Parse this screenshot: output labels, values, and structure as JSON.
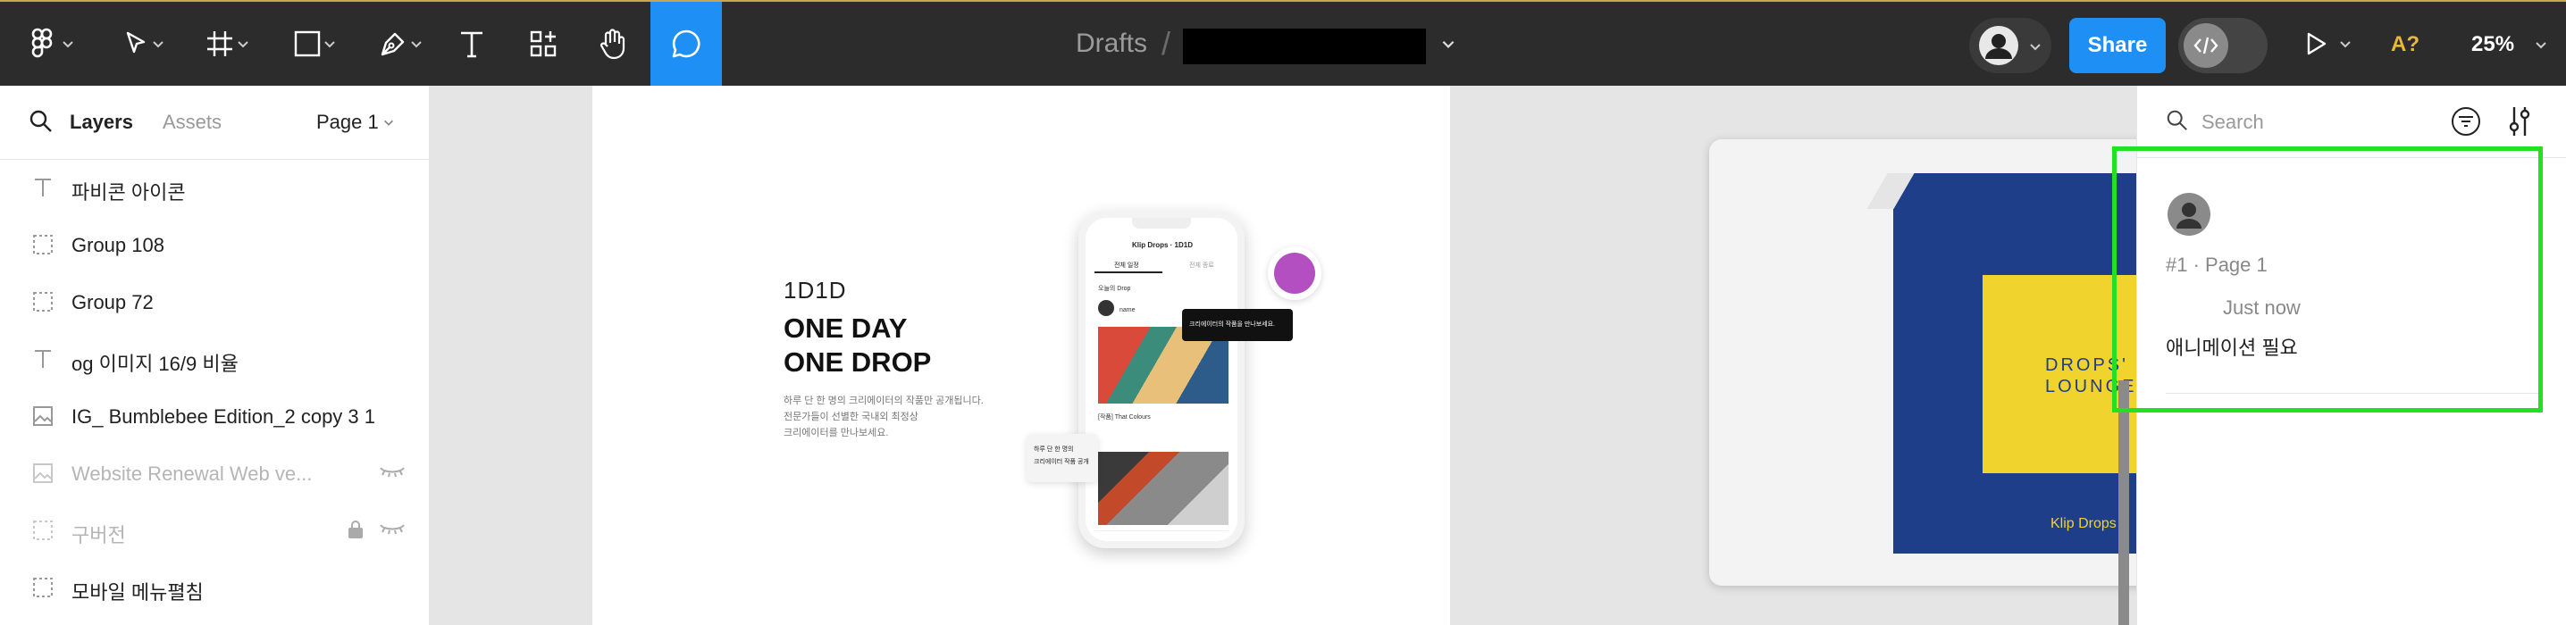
{
  "toolbar": {
    "breadcrumb_drafts": "Drafts",
    "breadcrumb_separator": "/",
    "share_label": "Share",
    "a11y_label": "A?",
    "zoom_level": "25%"
  },
  "left_panel": {
    "tabs": {
      "layers": "Layers",
      "assets": "Assets"
    },
    "page_selector": "Page 1",
    "layers": [
      {
        "name": "파비콘 아이콘",
        "icon": "text-icon",
        "dim": false
      },
      {
        "name": "Group 108",
        "icon": "frame-icon",
        "dim": false
      },
      {
        "name": "Group 72",
        "icon": "frame-icon",
        "dim": false
      },
      {
        "name": "og 이미지 16/9 비율",
        "icon": "text-icon",
        "dim": false
      },
      {
        "name": "IG_ Bumblebee Edition_2 copy 3 1",
        "icon": "image-icon",
        "dim": false
      },
      {
        "name": "Website Renewal Web ve...",
        "icon": "image-icon",
        "dim": true
      },
      {
        "name": "구버전",
        "icon": "frame-icon",
        "dim": true
      },
      {
        "name": "모바일 메뉴펼침",
        "icon": "frame-icon",
        "dim": false
      }
    ]
  },
  "canvas": {
    "hero": {
      "brand": "1D1D",
      "headline_1": "ONE DAY",
      "headline_2": "ONE DROP",
      "body_1": "하루 단 한 명의 크리에이터의 작품만 공개됩니다.",
      "body_2": "전문가들이 선별한 국내외 최정상",
      "body_3": "크리에이터를 만나보세요."
    },
    "phone": {
      "header": "Klip Drops · 1D1D",
      "tab_all": "전체 일정",
      "tab_done": "전체 종료",
      "today_drop": "오늘의 Drop",
      "artist_name": "name",
      "item_title": "[작품] That Colours",
      "tooltip": "크리에이터의 작품을 만나보세요.",
      "bubble_1": "하루 단 한 명의",
      "bubble_2": "크리에이터 작품 공개"
    },
    "drops_card": {
      "line1": "DROPS'",
      "line2": "LOUNGE",
      "brand": "Klip Drops"
    }
  },
  "right_panel": {
    "search_placeholder": "Search",
    "comment": {
      "thread": "#1 · Page 1",
      "time": "Just now",
      "text": "애니메이션 필요"
    }
  },
  "colors": {
    "toolbar_bg": "#2c2c2c",
    "accent_blue": "#1e90f5",
    "highlight_green": "#22e022",
    "purple_dot": "#b34fc0",
    "drops_blue": "#1f3e8a",
    "drops_yellow": "#f0d32c"
  }
}
